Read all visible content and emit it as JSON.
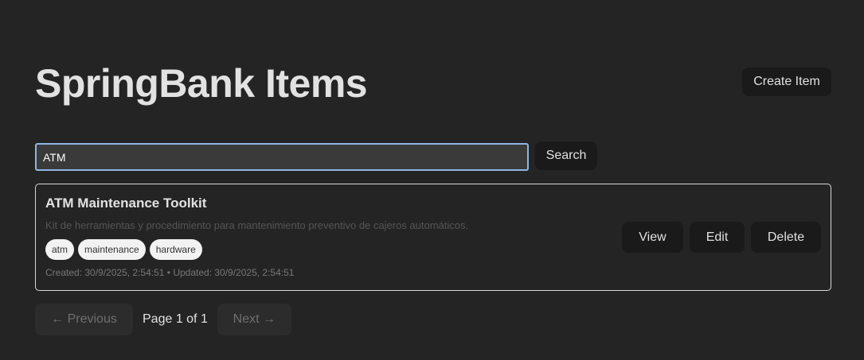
{
  "header": {
    "title": "SpringBank Items",
    "create_label": "Create Item"
  },
  "search": {
    "value": "ATM",
    "button_label": "Search"
  },
  "items": [
    {
      "title": "ATM Maintenance Toolkit",
      "description": "Kit de herramientas y procedimiento para mantenimiento preventivo de cajeros automáticos.",
      "tags": [
        "atm",
        "maintenance",
        "hardware"
      ],
      "meta": "Created: 30/9/2025, 2:54:51 • Updated: 30/9/2025, 2:54:51",
      "actions": {
        "view": "View",
        "edit": "Edit",
        "delete": "Delete"
      }
    }
  ],
  "pagination": {
    "previous_label": "← Previous",
    "page_label": "Page 1 of 1",
    "next_label": "Next →"
  }
}
